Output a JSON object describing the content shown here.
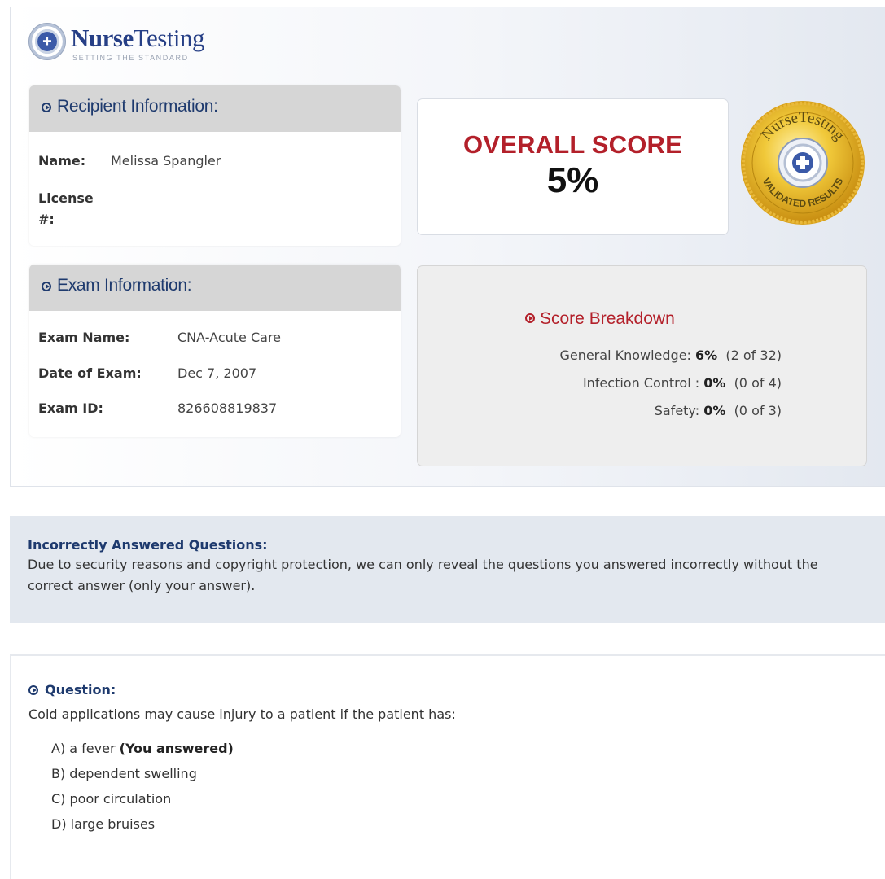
{
  "brand": {
    "name_bold": "Nurse",
    "name_regular": "Testing",
    "tagline": "SETTING THE STANDARD",
    "color": "#263f86"
  },
  "recipient": {
    "heading": "Recipient Information:",
    "name_label": "Name:",
    "name_value": "Melissa Spangler",
    "license_label": "License #:",
    "license_value": ""
  },
  "exam": {
    "heading": "Exam Information:",
    "name_label": "Exam Name:",
    "name_value": "CNA-Acute Care",
    "date_label": "Date of Exam:",
    "date_value": "Dec 7, 2007",
    "id_label": "Exam ID:",
    "id_value": "826608819837"
  },
  "overall": {
    "label": "OVERALL SCORE",
    "value": "5%",
    "label_color": "#b3202a"
  },
  "seal": {
    "top_text": "NurseTesting",
    "bottom_text": "VALIDATED RESULTS",
    "icon": "plus-cross-icon"
  },
  "breakdown": {
    "heading": "Score Breakdown",
    "items": [
      {
        "label": "General Knowledge:",
        "pct": "6%",
        "count": "(2 of 32)"
      },
      {
        "label": "Infection Control :",
        "pct": "0%",
        "count": "(0 of 4)"
      },
      {
        "label": "Safety:",
        "pct": "0%",
        "count": "(0 of 3)"
      }
    ]
  },
  "notice": {
    "title": "Incorrectly Answered Questions:",
    "text": "Due to security reasons and copyright protection, we can only reveal the questions you answered incorrectly without the correct answer (only your answer)."
  },
  "question": {
    "label": "Question:",
    "text": "Cold applications may cause injury to a patient if the patient has:",
    "choices": [
      {
        "text": "A) a fever",
        "marker": "(You answered)"
      },
      {
        "text": "B) dependent swelling",
        "marker": ""
      },
      {
        "text": "C) poor circulation",
        "marker": ""
      },
      {
        "text": "D) large bruises",
        "marker": ""
      }
    ]
  },
  "colors": {
    "heading_blue": "#1e3a6e",
    "accent_red": "#b3202a",
    "card_header_gray": "#d6d6d6",
    "notice_bg": "#e3e8ef",
    "seal_gold": "#e6b325"
  }
}
